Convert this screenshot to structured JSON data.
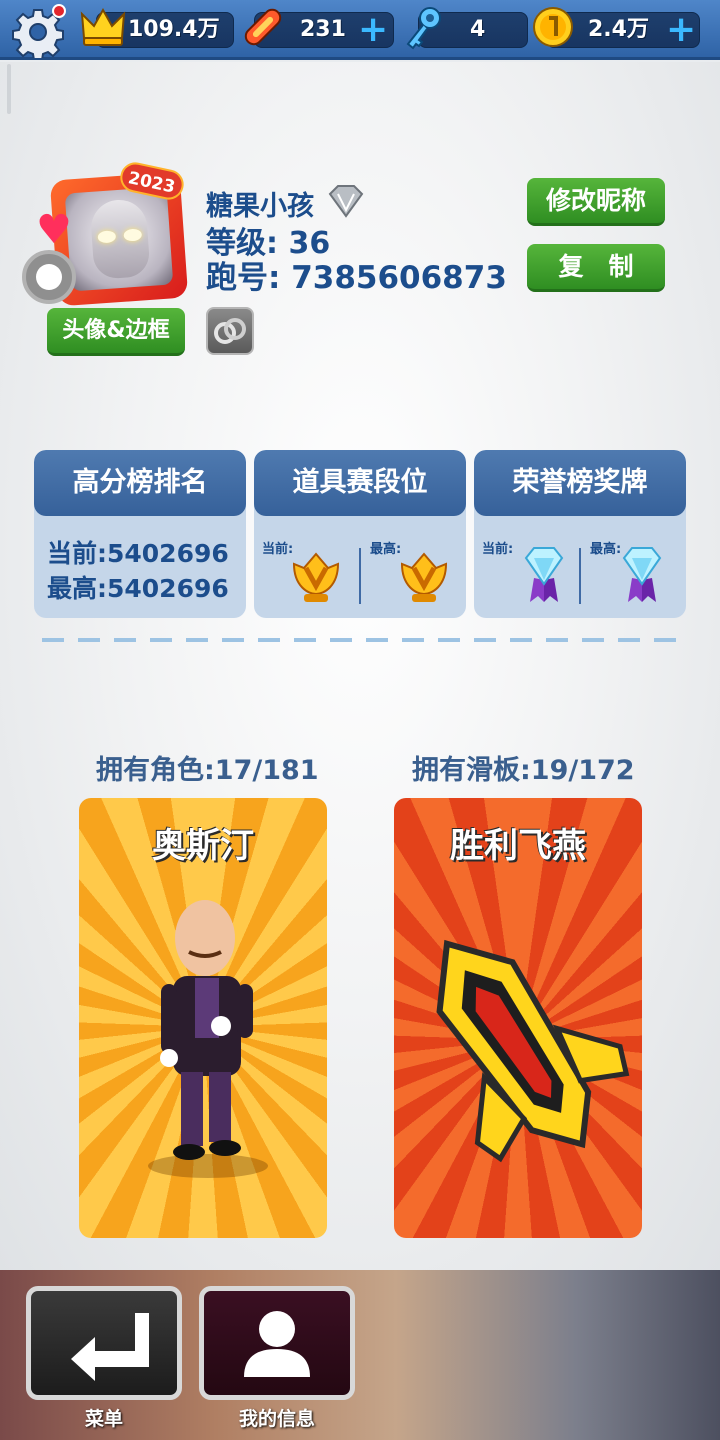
{
  "topbar": {
    "settings_icon": "gear-icon",
    "crown": {
      "icon": "crown-icon",
      "value": "109.4万"
    },
    "hoverboard": {
      "icon": "hoverboard-icon",
      "value": "231"
    },
    "keys": {
      "icon": "key-icon",
      "value": "4"
    },
    "coins": {
      "icon": "coin-icon",
      "value": "2.4万"
    },
    "plus_symbol": "+"
  },
  "profile": {
    "frame_year": "2023",
    "nickname": "糖果小孩",
    "level": "等级: 36",
    "player_id": "跑号: 7385606873",
    "avatar_frame_button": "头像&边框",
    "edit_nickname_button": "修改昵称",
    "copy_button": "复　制"
  },
  "stats": {
    "ranking": {
      "title": "高分榜排名",
      "current": "当前:5402696",
      "best": "最高:5402696"
    },
    "item_league": {
      "title": "道具赛段位",
      "current_label": "当前:",
      "best_label": "最高:"
    },
    "honor_medals": {
      "title": "荣誉榜奖牌",
      "current_label": "当前:",
      "best_label": "最高:"
    }
  },
  "collection": {
    "characters_owned": "拥有角色:17/181",
    "boards_owned": "拥有滑板:19/172",
    "character_name": "奥斯汀",
    "board_name": "胜利飞燕"
  },
  "bottom_nav": {
    "menu_label": "菜单",
    "my_info_label": "我的信息"
  },
  "colors": {
    "topbar": "#3a6fb3",
    "green_button": "#3fa22d",
    "card_head": "#42699f",
    "card_body": "#c5d6e9",
    "text_blue": "#1c4d8c",
    "character_card": "#f6a623",
    "board_card": "#e4451f"
  }
}
